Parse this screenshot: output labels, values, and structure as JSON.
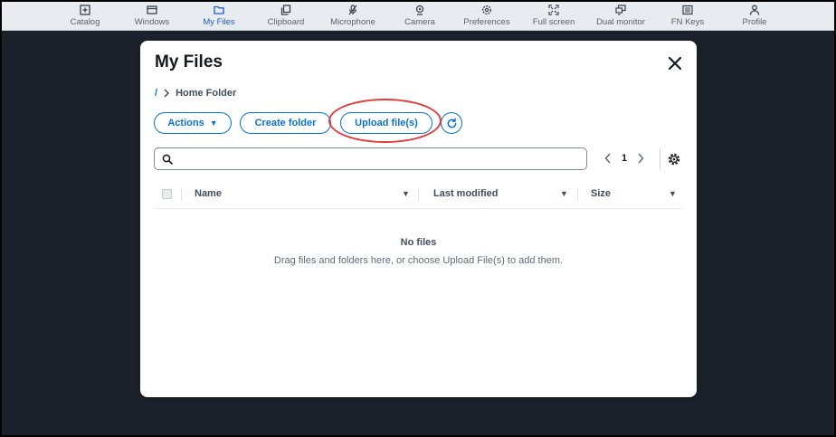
{
  "toolbar": {
    "items": [
      {
        "label": "Catalog",
        "icon": "plus-square-icon"
      },
      {
        "label": "Windows",
        "icon": "window-icon"
      },
      {
        "label": "My Files",
        "icon": "folder-icon",
        "active": true
      },
      {
        "label": "Clipboard",
        "icon": "clipboard-icon"
      },
      {
        "label": "Microphone",
        "icon": "microphone-icon"
      },
      {
        "label": "Camera",
        "icon": "camera-icon"
      },
      {
        "label": "Preferences",
        "icon": "gear-icon"
      },
      {
        "label": "Full screen",
        "icon": "fullscreen-icon"
      },
      {
        "label": "Dual monitor",
        "icon": "dual-monitor-icon"
      },
      {
        "label": "FN Keys",
        "icon": "keyboard-icon"
      },
      {
        "label": "Profile",
        "icon": "user-icon"
      }
    ]
  },
  "modal": {
    "title": "My Files",
    "breadcrumb": {
      "root": "/",
      "current": "Home Folder"
    },
    "buttons": {
      "actions": "Actions",
      "create_folder": "Create folder",
      "upload": "Upload file(s)"
    },
    "search": {
      "value": "",
      "placeholder": ""
    },
    "pagination": {
      "current_page": "1"
    },
    "table": {
      "columns": [
        "Name",
        "Last modified",
        "Size"
      ]
    },
    "empty": {
      "title": "No files",
      "description": "Drag files and folders here, or choose Upload File(s) to add them."
    }
  },
  "colors": {
    "accent": "#0972d3",
    "active_nav": "#1f5fbf",
    "backdrop": "#1c222c",
    "highlight": "#e23b3b"
  }
}
